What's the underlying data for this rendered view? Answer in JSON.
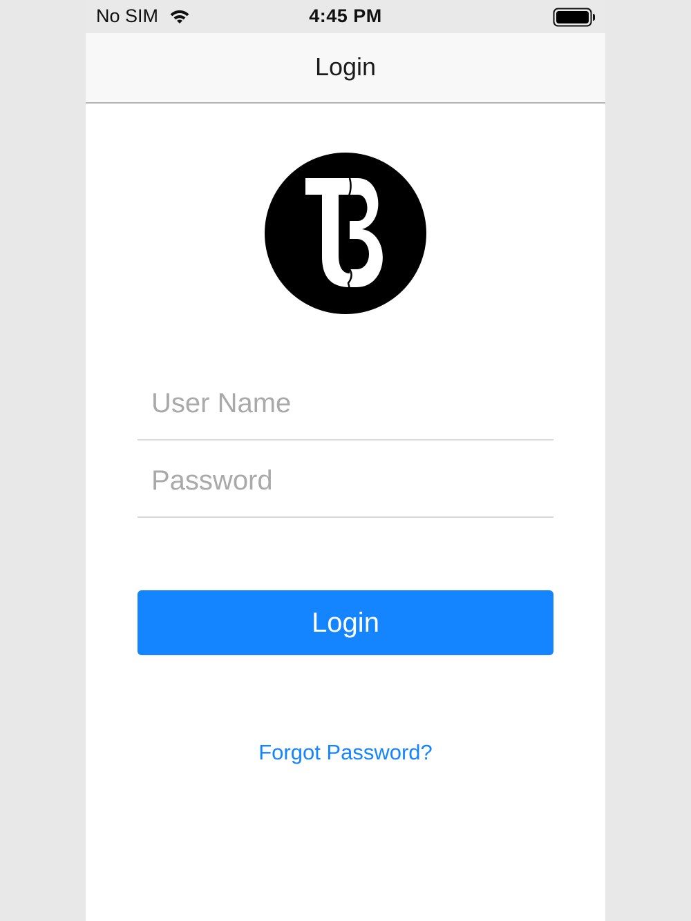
{
  "status_bar": {
    "carrier": "No SIM",
    "time": "4:45 PM",
    "wifi_icon": "wifi-icon",
    "battery_icon": "battery-full-icon"
  },
  "nav": {
    "title": "Login"
  },
  "logo": {
    "icon": "tb-logo"
  },
  "form": {
    "username_placeholder": "User Name",
    "username_value": "",
    "password_placeholder": "Password",
    "password_value": "",
    "login_label": "Login",
    "forgot_label": "Forgot Password?"
  },
  "colors": {
    "accent": "#1585ff",
    "status_bar_bg": "#e9e9e9",
    "nav_bg": "#f8f8f8",
    "page_bg": "#e8e8e8"
  }
}
